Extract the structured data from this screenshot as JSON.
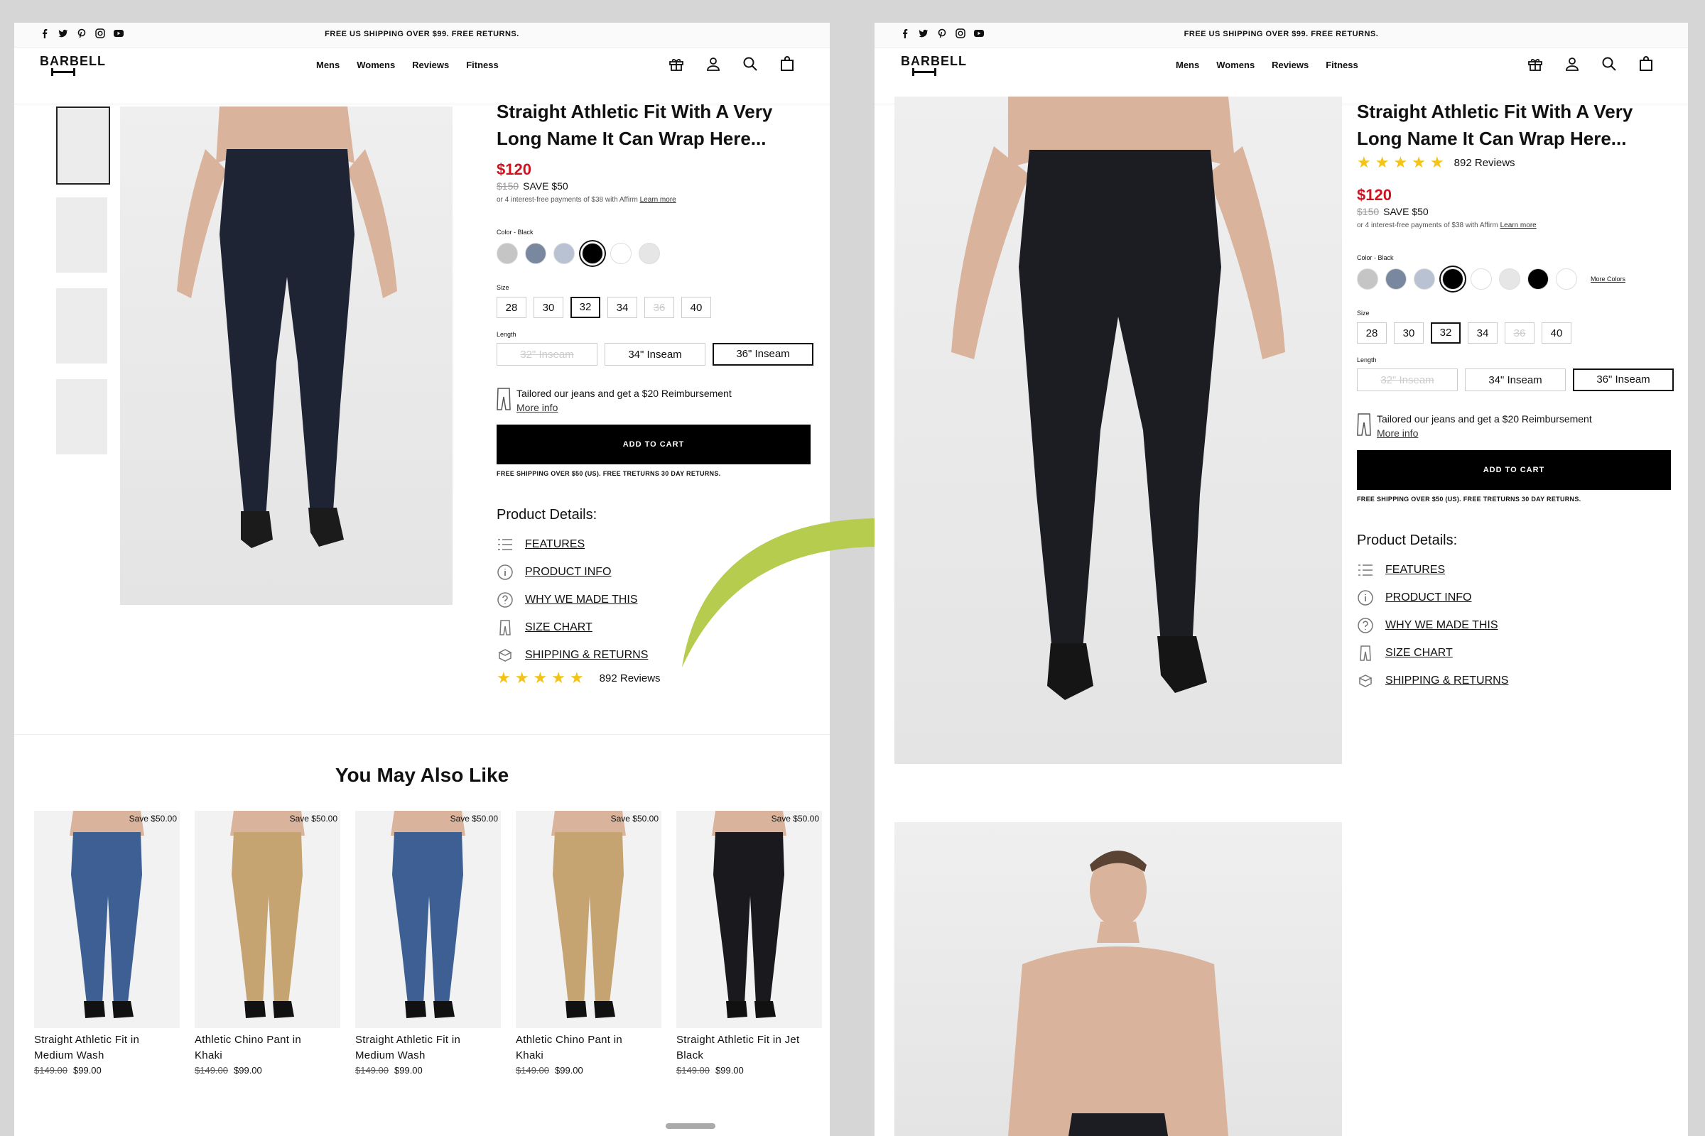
{
  "promo": "FREE US SHIPPING OVER $99. FREE RETURNS.",
  "brand": "BARBELL",
  "nav": [
    "Mens",
    "Womens",
    "Reviews",
    "Fitness"
  ],
  "icons": {
    "social": [
      "facebook-icon",
      "twitter-icon",
      "pinterest-icon",
      "instagram-icon",
      "youtube-icon"
    ],
    "header": [
      "gift-icon",
      "account-icon",
      "search-icon",
      "cart-icon"
    ]
  },
  "product": {
    "title_line1": "Straight Athletic Fit With A Very",
    "title_line2": "Long Name It Can Wrap Here...",
    "price": "$120",
    "old_price": "$150",
    "save": "SAVE $50",
    "affirm_text": "or 4 interest-free payments of $38 with Affirm",
    "affirm_link": "Learn more",
    "color_label": "Color - Black",
    "size_label": "Size",
    "sizes": [
      "28",
      "30",
      "32",
      "34",
      "36",
      "40"
    ],
    "selected_size": "32",
    "length_label": "Length",
    "lengths": [
      "32\" Inseam",
      "34\" Inseam",
      "36\" Inseam"
    ],
    "tailor_text": "Tailored our jeans and get a $20 Reimbursement",
    "tailor_link": "More info",
    "add_to_cart": "ADD TO CART",
    "ship_note": "FREE SHIPPING OVER $50 (US). FREE TRETURNS 30 DAY RETURNS.",
    "details_heading": "Product Details:",
    "details": [
      "FEATURES",
      "PRODUCT INFO",
      "WHY WE MADE THIS",
      "SIZE CHART",
      "SHIPPING & RETURNS"
    ],
    "rating": 5,
    "reviews": "892 Reviews",
    "more_colors": "More Colors"
  },
  "colors_left": [
    "#c5c5c5",
    "#7a889f",
    "#b8c2d2",
    "#000000",
    "#ffffff",
    "#e6e6e6"
  ],
  "colors_right": [
    "#c5c5c5",
    "#7a889f",
    "#b8c2d2",
    "#000000",
    "#ffffff",
    "#e6e6e6",
    "#000000",
    "#ffffff"
  ],
  "recommend": {
    "heading": "You May Also Like",
    "items": [
      {
        "save": "Save $50.00",
        "name1": "Straight Athletic Fit in",
        "name2": "Medium Wash",
        "old": "$149.00",
        "price": "$99.00",
        "color": "#3d5f94"
      },
      {
        "save": "Save $50.00",
        "name1": "Athletic Chino Pant in",
        "name2": "Khaki",
        "old": "$149.00",
        "price": "$99.00",
        "color": "#c6a472"
      },
      {
        "save": "Save $50.00",
        "name1": "Straight Athletic Fit in",
        "name2": "Medium Wash",
        "old": "$149.00",
        "price": "$99.00",
        "color": "#3d5f94"
      },
      {
        "save": "Save $50.00",
        "name1": "Athletic Chino Pant in",
        "name2": "Khaki",
        "old": "$149.00",
        "price": "$99.00",
        "color": "#c6a472"
      },
      {
        "save": "Save $50.00",
        "name1": "Straight Athletic Fit in Jet",
        "name2": "Black",
        "old": "$149.00",
        "price": "$99.00",
        "color": "#1a1a1e"
      }
    ]
  },
  "accent": "#b5cc4f"
}
